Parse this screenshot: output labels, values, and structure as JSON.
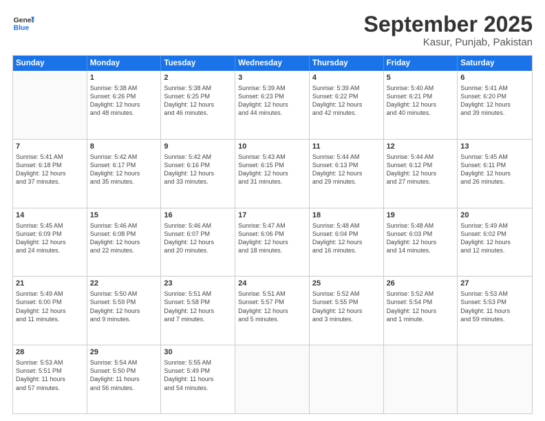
{
  "header": {
    "logo_general": "General",
    "logo_blue": "Blue",
    "month": "September 2025",
    "location": "Kasur, Punjab, Pakistan"
  },
  "weekdays": [
    "Sunday",
    "Monday",
    "Tuesday",
    "Wednesday",
    "Thursday",
    "Friday",
    "Saturday"
  ],
  "rows": [
    [
      {
        "day": "",
        "lines": []
      },
      {
        "day": "1",
        "lines": [
          "Sunrise: 5:38 AM",
          "Sunset: 6:26 PM",
          "Daylight: 12 hours",
          "and 48 minutes."
        ]
      },
      {
        "day": "2",
        "lines": [
          "Sunrise: 5:38 AM",
          "Sunset: 6:25 PM",
          "Daylight: 12 hours",
          "and 46 minutes."
        ]
      },
      {
        "day": "3",
        "lines": [
          "Sunrise: 5:39 AM",
          "Sunset: 6:23 PM",
          "Daylight: 12 hours",
          "and 44 minutes."
        ]
      },
      {
        "day": "4",
        "lines": [
          "Sunrise: 5:39 AM",
          "Sunset: 6:22 PM",
          "Daylight: 12 hours",
          "and 42 minutes."
        ]
      },
      {
        "day": "5",
        "lines": [
          "Sunrise: 5:40 AM",
          "Sunset: 6:21 PM",
          "Daylight: 12 hours",
          "and 40 minutes."
        ]
      },
      {
        "day": "6",
        "lines": [
          "Sunrise: 5:41 AM",
          "Sunset: 6:20 PM",
          "Daylight: 12 hours",
          "and 39 minutes."
        ]
      }
    ],
    [
      {
        "day": "7",
        "lines": [
          "Sunrise: 5:41 AM",
          "Sunset: 6:18 PM",
          "Daylight: 12 hours",
          "and 37 minutes."
        ]
      },
      {
        "day": "8",
        "lines": [
          "Sunrise: 5:42 AM",
          "Sunset: 6:17 PM",
          "Daylight: 12 hours",
          "and 35 minutes."
        ]
      },
      {
        "day": "9",
        "lines": [
          "Sunrise: 5:42 AM",
          "Sunset: 6:16 PM",
          "Daylight: 12 hours",
          "and 33 minutes."
        ]
      },
      {
        "day": "10",
        "lines": [
          "Sunrise: 5:43 AM",
          "Sunset: 6:15 PM",
          "Daylight: 12 hours",
          "and 31 minutes."
        ]
      },
      {
        "day": "11",
        "lines": [
          "Sunrise: 5:44 AM",
          "Sunset: 6:13 PM",
          "Daylight: 12 hours",
          "and 29 minutes."
        ]
      },
      {
        "day": "12",
        "lines": [
          "Sunrise: 5:44 AM",
          "Sunset: 6:12 PM",
          "Daylight: 12 hours",
          "and 27 minutes."
        ]
      },
      {
        "day": "13",
        "lines": [
          "Sunrise: 5:45 AM",
          "Sunset: 6:11 PM",
          "Daylight: 12 hours",
          "and 26 minutes."
        ]
      }
    ],
    [
      {
        "day": "14",
        "lines": [
          "Sunrise: 5:45 AM",
          "Sunset: 6:09 PM",
          "Daylight: 12 hours",
          "and 24 minutes."
        ]
      },
      {
        "day": "15",
        "lines": [
          "Sunrise: 5:46 AM",
          "Sunset: 6:08 PM",
          "Daylight: 12 hours",
          "and 22 minutes."
        ]
      },
      {
        "day": "16",
        "lines": [
          "Sunrise: 5:46 AM",
          "Sunset: 6:07 PM",
          "Daylight: 12 hours",
          "and 20 minutes."
        ]
      },
      {
        "day": "17",
        "lines": [
          "Sunrise: 5:47 AM",
          "Sunset: 6:06 PM",
          "Daylight: 12 hours",
          "and 18 minutes."
        ]
      },
      {
        "day": "18",
        "lines": [
          "Sunrise: 5:48 AM",
          "Sunset: 6:04 PM",
          "Daylight: 12 hours",
          "and 16 minutes."
        ]
      },
      {
        "day": "19",
        "lines": [
          "Sunrise: 5:48 AM",
          "Sunset: 6:03 PM",
          "Daylight: 12 hours",
          "and 14 minutes."
        ]
      },
      {
        "day": "20",
        "lines": [
          "Sunrise: 5:49 AM",
          "Sunset: 6:02 PM",
          "Daylight: 12 hours",
          "and 12 minutes."
        ]
      }
    ],
    [
      {
        "day": "21",
        "lines": [
          "Sunrise: 5:49 AM",
          "Sunset: 6:00 PM",
          "Daylight: 12 hours",
          "and 11 minutes."
        ]
      },
      {
        "day": "22",
        "lines": [
          "Sunrise: 5:50 AM",
          "Sunset: 5:59 PM",
          "Daylight: 12 hours",
          "and 9 minutes."
        ]
      },
      {
        "day": "23",
        "lines": [
          "Sunrise: 5:51 AM",
          "Sunset: 5:58 PM",
          "Daylight: 12 hours",
          "and 7 minutes."
        ]
      },
      {
        "day": "24",
        "lines": [
          "Sunrise: 5:51 AM",
          "Sunset: 5:57 PM",
          "Daylight: 12 hours",
          "and 5 minutes."
        ]
      },
      {
        "day": "25",
        "lines": [
          "Sunrise: 5:52 AM",
          "Sunset: 5:55 PM",
          "Daylight: 12 hours",
          "and 3 minutes."
        ]
      },
      {
        "day": "26",
        "lines": [
          "Sunrise: 5:52 AM",
          "Sunset: 5:54 PM",
          "Daylight: 12 hours",
          "and 1 minute."
        ]
      },
      {
        "day": "27",
        "lines": [
          "Sunrise: 5:53 AM",
          "Sunset: 5:53 PM",
          "Daylight: 11 hours",
          "and 59 minutes."
        ]
      }
    ],
    [
      {
        "day": "28",
        "lines": [
          "Sunrise: 5:53 AM",
          "Sunset: 5:51 PM",
          "Daylight: 11 hours",
          "and 57 minutes."
        ]
      },
      {
        "day": "29",
        "lines": [
          "Sunrise: 5:54 AM",
          "Sunset: 5:50 PM",
          "Daylight: 11 hours",
          "and 56 minutes."
        ]
      },
      {
        "day": "30",
        "lines": [
          "Sunrise: 5:55 AM",
          "Sunset: 5:49 PM",
          "Daylight: 11 hours",
          "and 54 minutes."
        ]
      },
      {
        "day": "",
        "lines": []
      },
      {
        "day": "",
        "lines": []
      },
      {
        "day": "",
        "lines": []
      },
      {
        "day": "",
        "lines": []
      }
    ]
  ]
}
